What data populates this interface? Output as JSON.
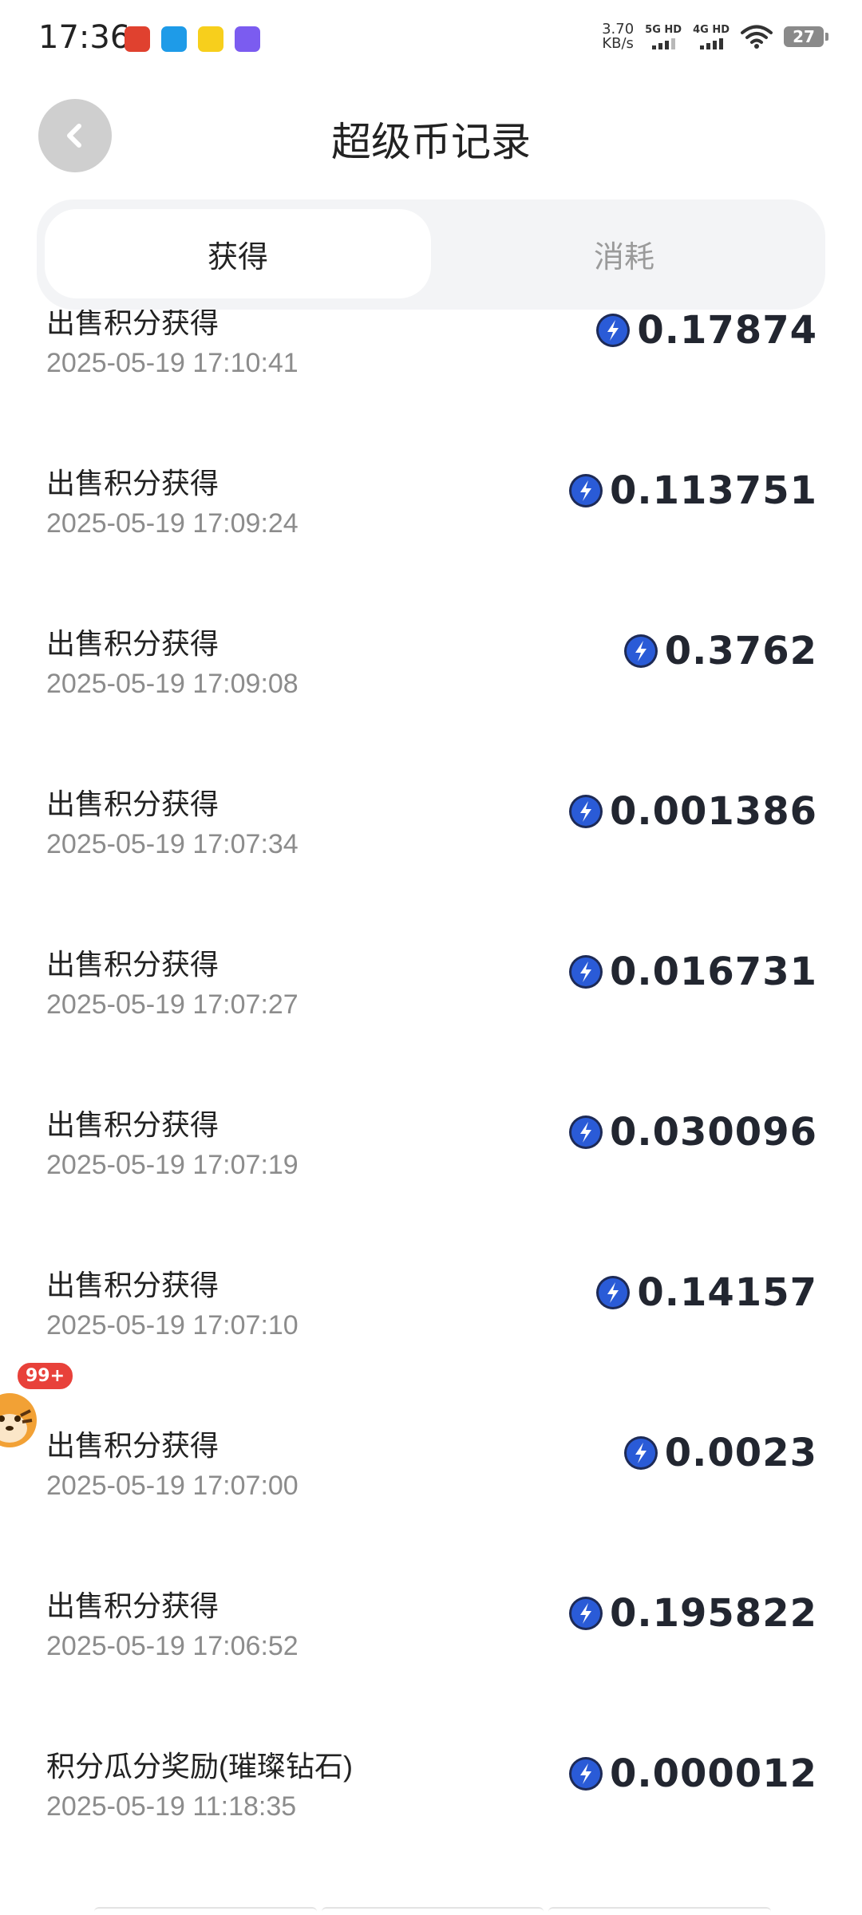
{
  "status_bar": {
    "time": "17:36",
    "net_speed_value": "3.70",
    "net_speed_unit": "KB/s",
    "sim1_label": "5G HD",
    "sim2_label": "4G HD",
    "battery": "27",
    "app_icons": [
      {
        "name": "app-icon-red",
        "color": "#e0412f"
      },
      {
        "name": "app-icon-blue",
        "color": "#1e9be8"
      },
      {
        "name": "app-icon-yellow",
        "color": "#f7cf1c"
      },
      {
        "name": "app-icon-purple",
        "color": "#7b5cf0"
      }
    ]
  },
  "header": {
    "title": "超级币记录",
    "back_icon": "chevron-left-icon"
  },
  "tabs": [
    {
      "label": "获得",
      "active": true
    },
    {
      "label": "消耗",
      "active": false
    }
  ],
  "records": [
    {
      "title": "出售积分获得",
      "time": "2025-05-19 17:10:41",
      "amount": "0.17874"
    },
    {
      "title": "出售积分获得",
      "time": "2025-05-19 17:09:24",
      "amount": "0.113751"
    },
    {
      "title": "出售积分获得",
      "time": "2025-05-19 17:09:08",
      "amount": "0.3762"
    },
    {
      "title": "出售积分获得",
      "time": "2025-05-19 17:07:34",
      "amount": "0.001386"
    },
    {
      "title": "出售积分获得",
      "time": "2025-05-19 17:07:27",
      "amount": "0.016731"
    },
    {
      "title": "出售积分获得",
      "time": "2025-05-19 17:07:19",
      "amount": "0.030096"
    },
    {
      "title": "出售积分获得",
      "time": "2025-05-19 17:07:10",
      "amount": "0.14157"
    },
    {
      "title": "出售积分获得",
      "time": "2025-05-19 17:07:00",
      "amount": "0.0023"
    },
    {
      "title": "出售积分获得",
      "time": "2025-05-19 17:06:52",
      "amount": "0.195822"
    },
    {
      "title": "积分瓜分奖励(璀璨钻石)",
      "time": "2025-05-19 11:18:35",
      "amount": "0.000012"
    }
  ],
  "floating_widget": {
    "badge": "99+"
  },
  "colors": {
    "coin_blue": "#2a5bd7",
    "tab_bg": "#f3f4f6",
    "inactive_tab_text": "#9a9a9a"
  }
}
